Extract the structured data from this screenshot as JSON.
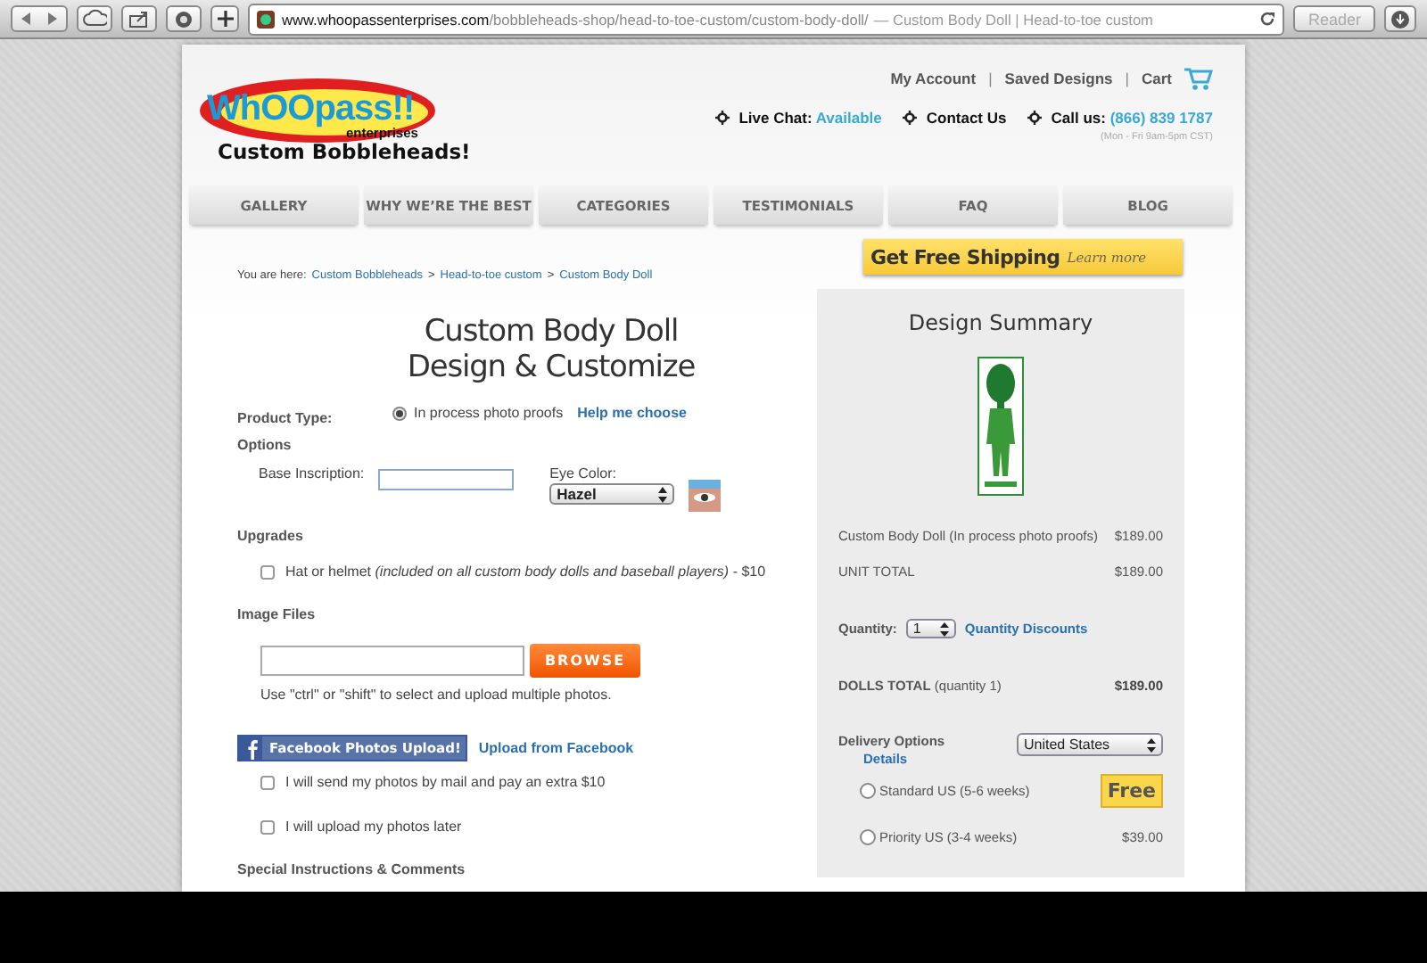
{
  "browser": {
    "url_domain": "www.whoopassenterprises.com",
    "url_path": "/bobbleheads-shop/head-to-toe-custom/custom-body-doll/",
    "page_title": "— Custom Body Doll | Head-to-toe custom",
    "reader": "Reader"
  },
  "header": {
    "logo_word": "WhOOpass!!",
    "logo_sub": "enterprises",
    "tagline": "Custom Bobbleheads!",
    "account_links": [
      "My Account",
      "Saved Designs",
      "Cart"
    ],
    "link_separator": "|",
    "contact": [
      {
        "label": "Live Chat:",
        "value": "Available"
      },
      {
        "label": "Contact Us"
      },
      {
        "label": "Call us:",
        "value": "(866) 839 1787"
      }
    ],
    "hours": "(Mon - Fri 9am-5pm CST)"
  },
  "nav": [
    "GALLERY",
    "WHY WE’RE THE BEST",
    "CATEGORIES",
    "TESTIMONIALS",
    "FAQ",
    "BLOG"
  ],
  "breadcrumb": {
    "prefix": "You are here:",
    "separator": ">",
    "items": [
      "Custom Bobbleheads",
      "Head-to-toe custom",
      "Custom Body Doll"
    ]
  },
  "form": {
    "title": [
      "Custom Body Doll",
      "Design & Customize"
    ],
    "product_type": {
      "label": "Product Type:",
      "option": "In process photo proofs",
      "selected": true,
      "help": "Help me choose"
    },
    "options_heading": "Options",
    "inscription_label": "Base Inscription:",
    "eye_label": "Eye Color:",
    "eye_value": "Hazel",
    "upgrades_heading": "Upgrades",
    "upgrade": {
      "text": "Hat or helmet *(included on all custom body dolls and baseball players)* - $10",
      "checked": false
    },
    "image_heading": "Image Files",
    "browse": "BROWSE",
    "hint": "Use \"ctrl\" or \"shift\" to select and upload multiple photos.",
    "facebook_button": "Facebook Photos Upload!",
    "facebook_link": "Upload from Facebook",
    "photo_options": [
      {
        "label": "I will send my photos by mail and pay an extra $10",
        "checked": false
      },
      {
        "label": "I will upload my photos later",
        "checked": false
      }
    ],
    "special_heading": "Special Instructions & Comments"
  },
  "summary": {
    "shipping": "Get Free Shipping",
    "shipping_link": "Learn more",
    "title": "Design Summary",
    "lines": [
      {
        "label": "Custom Body Doll (In process photo proofs)",
        "price": "$189.00"
      },
      {
        "label": "UNIT TOTAL",
        "price": "$189.00"
      }
    ],
    "quantity": {
      "label": "Quantity:",
      "value": "1",
      "link": "Quantity Discounts"
    },
    "dolls_total": {
      "label": "DOLLS TOTAL",
      "note": "(quantity 1)",
      "price": "$189.00"
    },
    "delivery": {
      "label": "Delivery Options",
      "details": "Details",
      "country": "United States",
      "options": [
        {
          "label": "Standard US (5-6 weeks)",
          "price": "Free",
          "kind": "badge",
          "selected": false
        },
        {
          "label": "Priority US (3-4 weeks)",
          "price": "$39.00",
          "kind": "plain",
          "selected": false
        }
      ]
    }
  }
}
